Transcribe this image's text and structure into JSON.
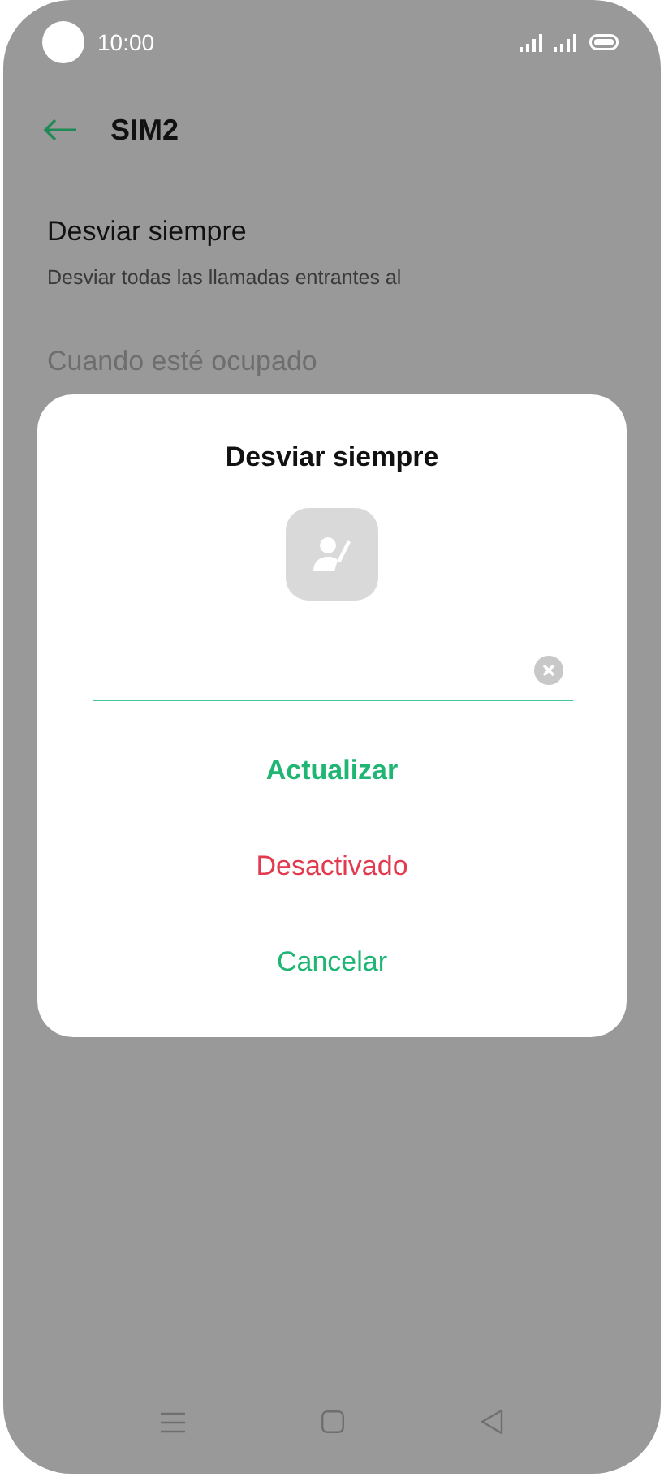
{
  "status_bar": {
    "time": "10:00"
  },
  "header": {
    "title": "SIM2"
  },
  "settings": [
    {
      "title": "Desviar siempre",
      "subtitle": "Desviar todas las llamadas entrantes al",
      "disabled": false
    },
    {
      "title": "Cuando esté ocupado",
      "disabled": true
    }
  ],
  "dialog": {
    "title": "Desviar siempre",
    "buttons": [
      {
        "label": "Actualizar",
        "kind": "primary"
      },
      {
        "label": "Desactivado",
        "kind": "destructive"
      },
      {
        "label": "Cancelar",
        "kind": "normal"
      }
    ]
  }
}
